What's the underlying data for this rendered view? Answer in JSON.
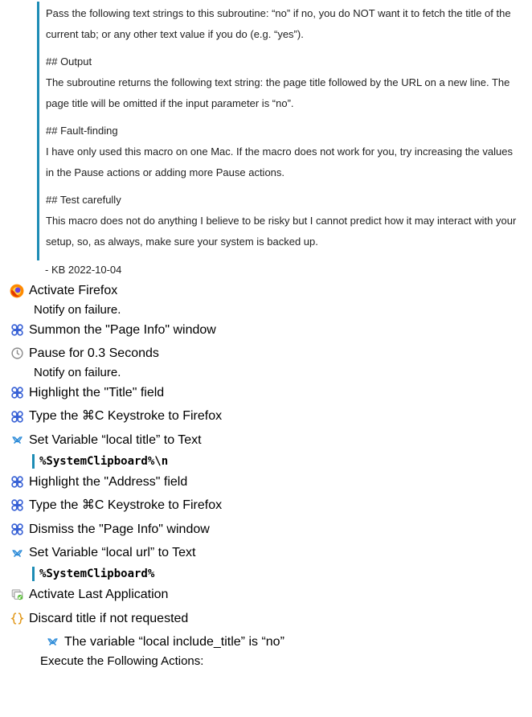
{
  "note": {
    "paragraphs": [
      "Pass the following text strings to this subroutine: “no” if no, you do NOT want it to fetch the title of the current tab; or any other text value if you do (e.g. “yes”).",
      "## Output",
      "The subroutine returns the following text string: the page title followed by the URL on a new line. The page title will be omitted if the input parameter is “no”.",
      "## Fault-finding",
      "I have only used this macro on one Mac. If the macro does not work for you, try increasing the values in the Pause actions or adding more Pause actions.",
      "## Test carefully",
      "This macro does not do anything I believe to be risky but I cannot predict how it may interact with your setup, so, as always, make sure your system is backed up."
    ],
    "signoff": "- KB 2022-10-04"
  },
  "actions": {
    "a0": {
      "icon": "firefox",
      "label": "Activate Firefox",
      "sub": "Notify on failure."
    },
    "a1": {
      "icon": "cmd",
      "label": "Summon the \"Page Info\" window"
    },
    "a2": {
      "icon": "clock",
      "label": "Pause for 0.3 Seconds",
      "sub": "Notify on failure."
    },
    "a3": {
      "icon": "cmd",
      "label": "Highlight the \"Title\" field"
    },
    "a4": {
      "icon": "cmd",
      "label": "Type the ⌘C Keystroke to Firefox"
    },
    "a5": {
      "icon": "var",
      "label": "Set Variable “local title” to Text",
      "bar": "%SystemClipboard%\\n"
    },
    "a6": {
      "icon": "cmd",
      "label": "Highlight the \"Address\" field"
    },
    "a7": {
      "icon": "cmd",
      "label": "Type the ⌘C Keystroke to Firefox"
    },
    "a8": {
      "icon": "cmd",
      "label": "Dismiss the \"Page Info\" window"
    },
    "a9": {
      "icon": "var",
      "label": "Set Variable “local url” to Text",
      "bar": "%SystemClipboard%"
    },
    "a10": {
      "icon": "lastapp",
      "label": "Activate Last Application"
    },
    "a11": {
      "icon": "braces",
      "label": "Discard title if not requested",
      "cond_icon": "var",
      "cond": "The variable “local include_title” is “no”",
      "exec": "Execute the Following Actions:"
    }
  }
}
